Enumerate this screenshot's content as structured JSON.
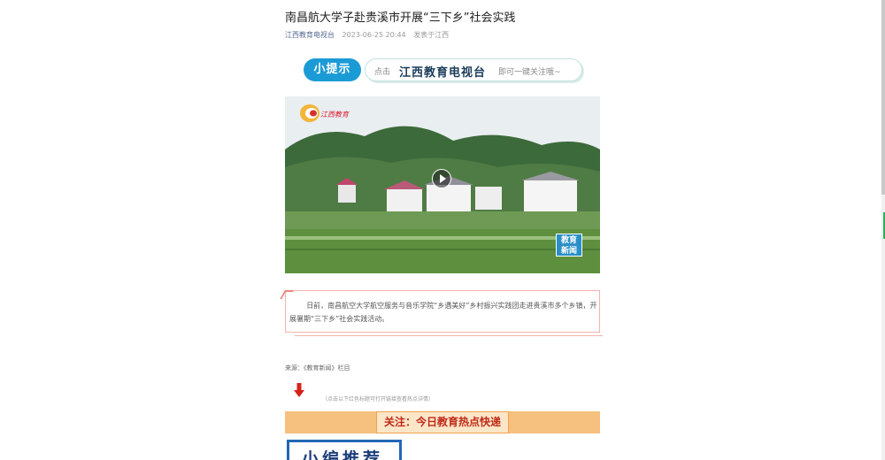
{
  "article": {
    "title": "南昌航大学子赴贵溪市开展“三下乡”社会实践",
    "author": "江西教育电视台",
    "date": "2023-06-25 20:44",
    "location": "发表于江西"
  },
  "tip": {
    "badge": "小提示",
    "pre": "点击",
    "account": "江西教育电视台",
    "post": "即可一键关注哦~"
  },
  "video": {
    "logo_text": "江西教育",
    "news_badge_line1": "教育",
    "news_badge_line2": "新闻"
  },
  "summary": {
    "text": "日前，南昌航空大学航空服务与音乐学院“乡遇美好”乡村振兴实践团走进贵溪市多个乡镇，开展暑期“三下乡”社会实践活动。"
  },
  "source": "来源：《教育新闻》栏目",
  "hint": "（点击以下红色标题可打开链接查看热点详情）",
  "follow": "关注：今日教育热点快递",
  "editor_pick": "小编推荐",
  "colors": {
    "accent_blue": "#1b9bd6",
    "follow_bar": "#f6c07e",
    "follow_text": "#c02a18",
    "summary_border": "#f2b3ad"
  }
}
